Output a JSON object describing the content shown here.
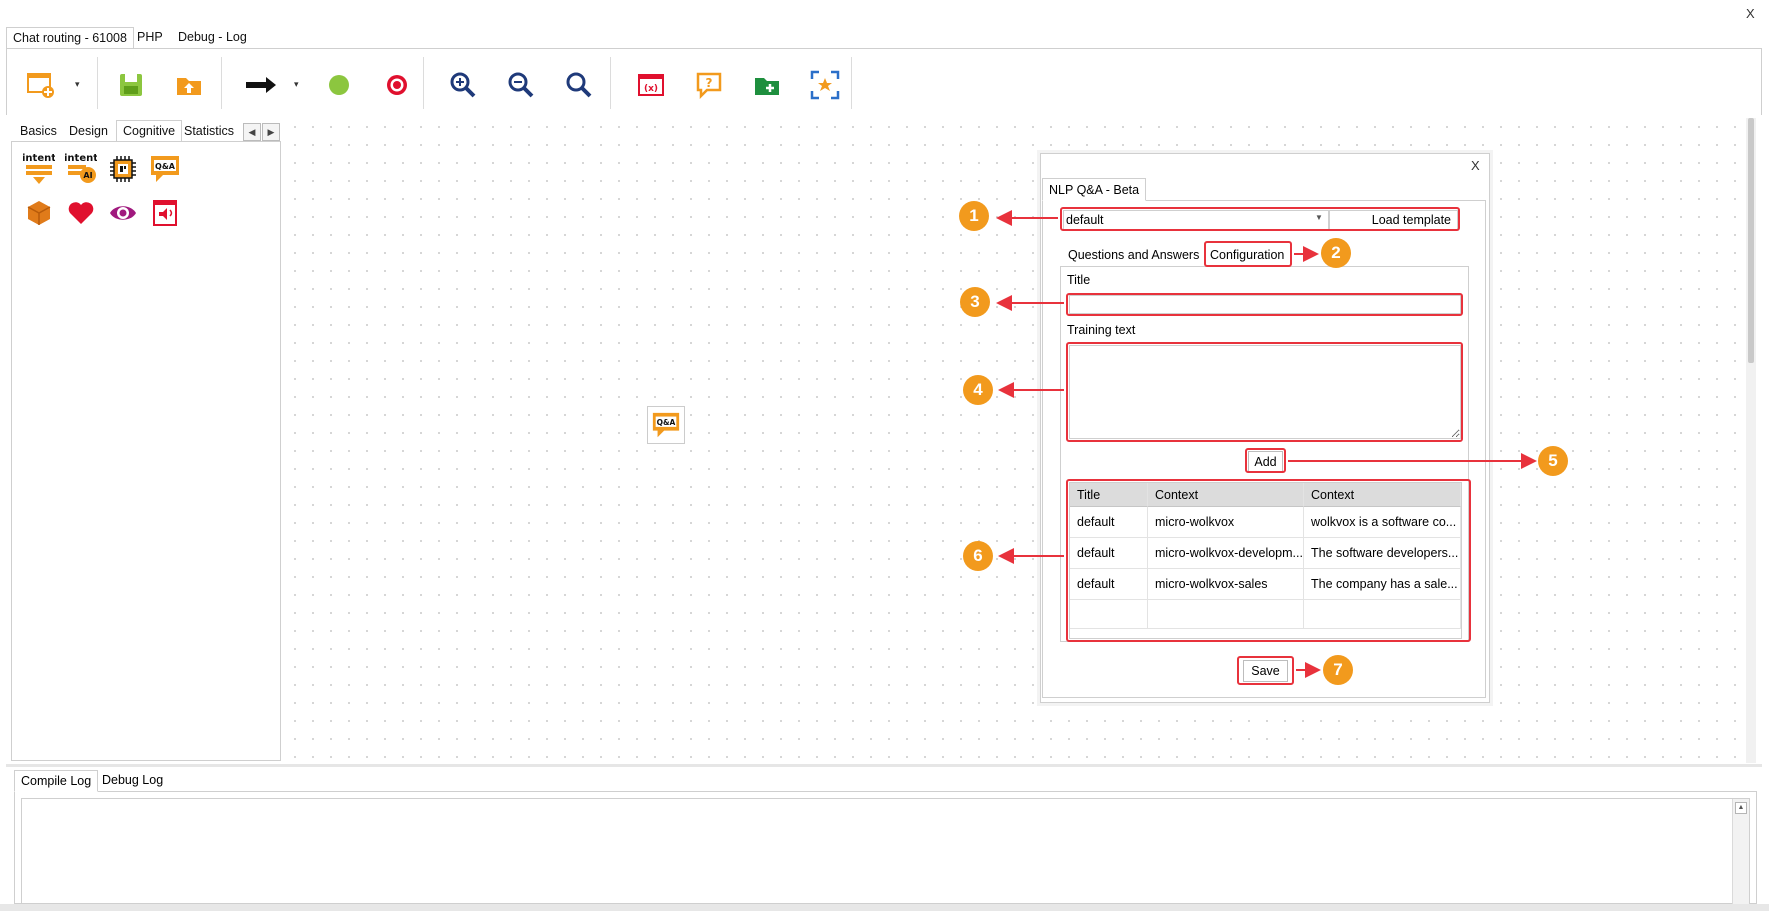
{
  "window": {
    "close_label": "X"
  },
  "top_tabs": [
    {
      "label": "Chat routing - 61008",
      "active": true
    },
    {
      "label": "PHP",
      "active": false
    },
    {
      "label": "Debug - Log",
      "active": false
    }
  ],
  "toolbar": {
    "buttons": [
      "new-flow-icon",
      "save-icon",
      "upload-folder-icon",
      "arrow-right-icon",
      "green-circle-icon",
      "red-target-icon",
      "zoom-in-icon",
      "zoom-out-icon",
      "zoom-fit-icon",
      "variable-icon",
      "question-bubble-icon",
      "add-folder-icon",
      "select-all-icon"
    ]
  },
  "left_panel": {
    "tabs": [
      {
        "label": "Basics",
        "active": false
      },
      {
        "label": "Design",
        "active": false
      },
      {
        "label": "Cognitive",
        "active": true
      },
      {
        "label": "Statistics",
        "active": false
      }
    ],
    "palette": [
      {
        "name": "intent-icon",
        "text": "intent"
      },
      {
        "name": "intent-ai-icon",
        "text": "intent",
        "sub": "AI"
      },
      {
        "name": "chip-icon"
      },
      {
        "name": "qa-bubble-icon",
        "text": "Q&A"
      },
      {
        "name": "box-icon"
      },
      {
        "name": "heart-icon"
      },
      {
        "name": "eye-icon"
      },
      {
        "name": "speaker-card-icon"
      }
    ]
  },
  "canvas": {
    "node_label": "Q&A"
  },
  "dialog": {
    "close_label": "X",
    "tab_label": "NLP Q&A - Beta",
    "template_value": "default",
    "load_template_label": "Load template",
    "sub_tabs": [
      {
        "label": "Questions and Answers",
        "active": false
      },
      {
        "label": "Configuration",
        "active": true
      }
    ],
    "title_label": "Title",
    "title_value": "",
    "training_label": "Training text",
    "training_value": "",
    "add_label": "Add",
    "save_label": "Save",
    "grid": {
      "headers": [
        "Title",
        "Context",
        "Context"
      ],
      "rows": [
        [
          "default",
          "micro-wolkvox",
          "wolkvox is a software co..."
        ],
        [
          "default",
          "micro-wolkvox-developm...",
          "The software developers..."
        ],
        [
          "default",
          "micro-wolkvox-sales",
          "The company has a sale..."
        ]
      ]
    }
  },
  "annotations": [
    "1",
    "2",
    "3",
    "4",
    "5",
    "6",
    "7"
  ],
  "log": {
    "tabs": [
      {
        "label": "Compile Log",
        "active": true
      },
      {
        "label": "Debug Log",
        "active": false
      }
    ]
  },
  "colors": {
    "annotation_red": "#e8323c",
    "badge_orange": "#f29a1d",
    "accent_orange": "#f29a1d"
  }
}
